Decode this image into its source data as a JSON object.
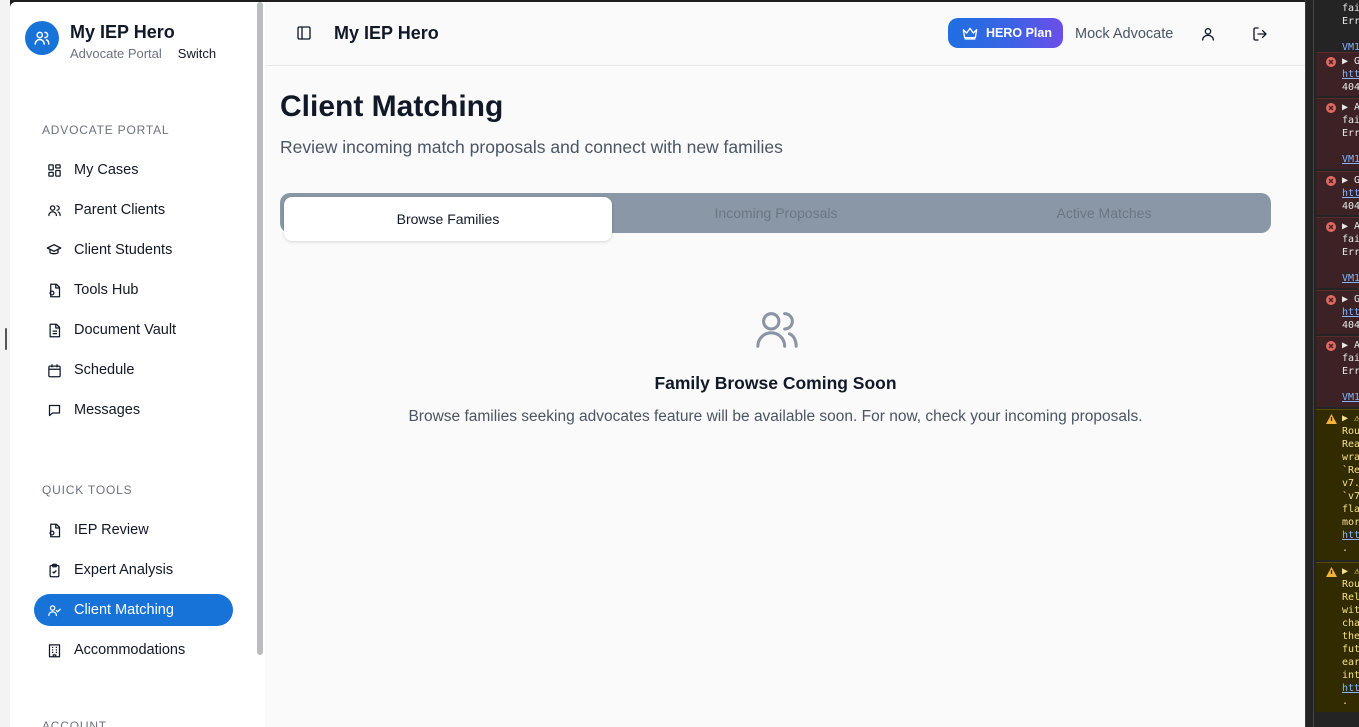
{
  "brand": {
    "title": "My IEP Hero",
    "role": "Advocate Portal",
    "switch_label": "Switch"
  },
  "sidebar": {
    "section_portal": "ADVOCATE PORTAL",
    "portal_items": [
      {
        "label": "My Cases",
        "icon": "grid-icon"
      },
      {
        "label": "Parent Clients",
        "icon": "users-icon"
      },
      {
        "label": "Client Students",
        "icon": "graduation-cap-icon"
      },
      {
        "label": "Tools Hub",
        "icon": "file-icon"
      },
      {
        "label": "Document Vault",
        "icon": "document-icon"
      },
      {
        "label": "Schedule",
        "icon": "calendar-icon"
      },
      {
        "label": "Messages",
        "icon": "message-icon"
      }
    ],
    "section_tools": "QUICK TOOLS",
    "tool_items": [
      {
        "label": "IEP Review",
        "icon": "file-search-icon"
      },
      {
        "label": "Expert Analysis",
        "icon": "clipboard-check-icon"
      },
      {
        "label": "Client Matching",
        "icon": "user-check-icon",
        "active": true
      },
      {
        "label": "Accommodations",
        "icon": "building-icon"
      }
    ],
    "section_account": "ACCOUNT"
  },
  "header": {
    "title": "My IEP Hero",
    "plan_label": "HERO Plan",
    "user_name": "Mock Advocate"
  },
  "main": {
    "title": "Client Matching",
    "subtitle": "Review incoming match proposals and connect with new families",
    "tabs": [
      {
        "label": "Browse Families",
        "active": true
      },
      {
        "label": "Incoming Proposals",
        "active": false
      },
      {
        "label": "Active Matches",
        "active": false
      }
    ],
    "empty_title": "Family Browse Coming Soon",
    "empty_desc": "Browse families seeking advocates feature will be available soon. For now, check your incoming proposals."
  },
  "devtools": {
    "rows": [
      {
        "type": "plain",
        "lines": [
          "fai",
          "Err",
          "",
          "VM1"
        ]
      },
      {
        "type": "err",
        "lines": [
          "▶ G",
          "htt",
          "404"
        ]
      },
      {
        "type": "err",
        "lines": [
          "▶ A",
          "fai",
          "Err",
          "",
          "VM1"
        ]
      },
      {
        "type": "err",
        "lines": [
          "▶ G",
          "htt",
          "404"
        ]
      },
      {
        "type": "err",
        "lines": [
          "▶ A",
          "fai",
          "Err",
          "",
          "VM1"
        ]
      },
      {
        "type": "err",
        "lines": [
          "▶ G",
          "htt",
          "404"
        ]
      },
      {
        "type": "err",
        "lines": [
          "▶ A",
          "fai",
          "Err",
          "",
          "VM1"
        ]
      },
      {
        "type": "warn",
        "lines": [
          "▶ ⚠",
          "Rou",
          "Rea",
          "wra",
          "`Re",
          "v7.",
          "`v7",
          "fla",
          "mor",
          "htt",
          "."
        ]
      },
      {
        "type": "warn",
        "lines": [
          "▶ ⚠",
          "Rou",
          "Rel",
          "wit",
          "cha",
          "the",
          "fut",
          "ear",
          "int",
          "htt",
          "."
        ]
      }
    ]
  },
  "colors": {
    "accent": "#1773d8",
    "tabs_bg": "#8a97a6",
    "plan_gradient_end": "#6c4ee8"
  }
}
